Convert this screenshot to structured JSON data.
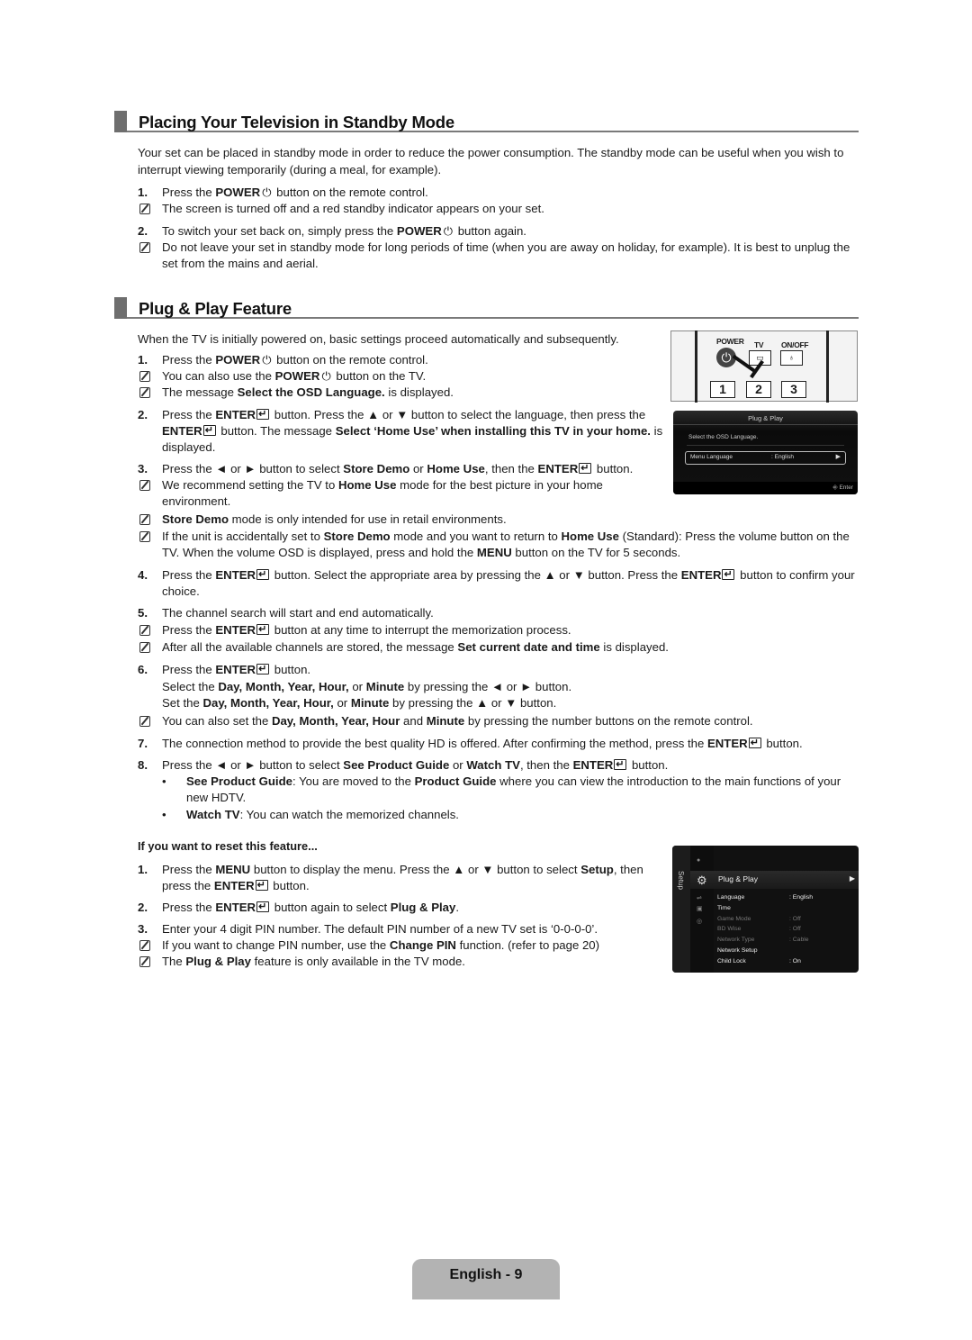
{
  "section1": {
    "title": "Placing Your Television in Standby Mode",
    "intro": "Your set can be placed in standby mode in order to reduce the power consumption. The standby mode can be useful when you wish to interrupt viewing temporarily (during a meal, for example).",
    "steps": [
      {
        "num": "1.",
        "pre": "Press the ",
        "bold": "POWER",
        "post": " button on the remote control.",
        "notes": [
          "The screen is turned off and a red standby indicator appears on your set."
        ]
      },
      {
        "num": "2.",
        "pre": "To switch your set back on, simply press the ",
        "bold": "POWER",
        "post": " button again.",
        "notes": [
          "Do not leave your set in standby mode for long periods of time (when you are away on holiday, for example). It is best to unplug the set from the mains and aerial."
        ]
      }
    ]
  },
  "section2": {
    "title": "Plug & Play Feature",
    "intro": "When the TV is initially powered on, basic settings proceed automatically and subsequently.",
    "step1": {
      "num": "1.",
      "text_a": "Press the ",
      "bold": "POWER",
      "text_b": " button on the remote control.",
      "note1_a": "You can also use the ",
      "note1_bold": "POWER",
      "note1_b": " button on the TV.",
      "note2_a": "The message ",
      "note2_bold": "Select the OSD Language.",
      "note2_b": " is displayed."
    },
    "step2": {
      "num": "2.",
      "a": "Press the ",
      "b1": "ENTER",
      "c": " button. Press the ▲ or ▼ button to select the language, then press the ",
      "b2": "ENTER",
      "d": " button. The message ",
      "b3": "Select ‘Home Use’ when installing this TV in your home.",
      "e": " is displayed."
    },
    "step3": {
      "num": "3.",
      "a": "Press the ◄ or ► button to select ",
      "b1": "Store Demo",
      "c": " or ",
      "b2": "Home Use",
      "d": ", then the ",
      "b3": "ENTER",
      "e": " button.",
      "note1_a": "We recommend setting the TV to ",
      "note1_bold": "Home Use",
      "note1_b": " mode for the best picture in your home environment.",
      "note2_bold": "Store Demo",
      "note2_b": " mode is only intended for use in retail environments.",
      "note3_a": "If the unit is accidentally set to ",
      "note3_b1": "Store Demo",
      "note3_c": " mode and you want to return to ",
      "note3_b2": "Home Use",
      "note3_d": " (Standard): Press the volume button on the TV. When the volume OSD is displayed, press and hold the ",
      "note3_b3": "MENU",
      "note3_e": " button on the TV for 5 seconds."
    },
    "step4": {
      "num": "4.",
      "a": "Press the ",
      "b1": "ENTER",
      "c": " button. Select the appropriate area by pressing the ▲ or ▼ button. Press the ",
      "b2": "ENTER",
      "d": " button to confirm your choice."
    },
    "step5": {
      "num": "5.",
      "a": "The channel search will start and end automatically.",
      "note1_a": "Press the ",
      "note1_bold": "ENTER",
      "note1_b": " button at any time to interrupt the memorization process.",
      "note2_a": "After all the available channels are stored, the message ",
      "note2_bold": "Set current date and time",
      "note2_b": " is displayed."
    },
    "step6": {
      "num": "6.",
      "a": "Press the ",
      "b1": "ENTER",
      "c": " button.",
      "line2_a": "Select the ",
      "line2_bold": "Day, Month, Year, Hour,",
      "line2_b": " or ",
      "line2_bold2": "Minute",
      "line2_c": " by pressing the ◄ or ► button.",
      "line3_a": "Set the ",
      "line3_bold": "Day, Month, Year, Hour,",
      "line3_b": " or ",
      "line3_bold2": "Minute",
      "line3_c": " by pressing the ▲ or ▼ button.",
      "note_a": "You can also set the ",
      "note_bold": "Day, Month, Year, Hour",
      "note_b": " and ",
      "note_bold2": "Minute",
      "note_c": " by pressing the number buttons on the remote control."
    },
    "step7": {
      "num": "7.",
      "a": "The connection method to provide the best quality HD is offered. After confirming the method, press the ",
      "b1": "ENTER",
      "c": " button."
    },
    "step8": {
      "num": "8.",
      "a": "Press the ◄ or ► button to select ",
      "b1": "See Product Guide",
      "c": " or ",
      "b2": "Watch TV",
      "d": ", then the ",
      "b3": "ENTER",
      "e": " button.",
      "bullet1_bold": "See Product Guide",
      "bullet1_a": ": You are moved to the ",
      "bullet1_bold2": "Product Guide",
      "bullet1_b": " where you can view the introduction to the main functions of your new HDTV.",
      "bullet2_bold": "Watch TV",
      "bullet2_a": ": You can watch the memorized channels."
    },
    "reset": {
      "heading": "If you want to reset this feature...",
      "s1_num": "1.",
      "s1_a": "Press the ",
      "s1_b1": "MENU",
      "s1_c": " button to display the menu. Press the ▲ or ▼ button to select ",
      "s1_b2": "Setup",
      "s1_d": ", then press the ",
      "s1_b3": "ENTER",
      "s1_e": " button.",
      "s2_num": "2.",
      "s2_a": "Press the ",
      "s2_b1": "ENTER",
      "s2_c": " button again to select ",
      "s2_b2": "Plug & Play",
      "s2_d": ".",
      "s3_num": "3.",
      "s3_a": "Enter your 4 digit PIN number. The default PIN number of a new TV set is ‘0-0-0-0’.",
      "s3_note1_a": "If you want to change PIN number, use the ",
      "s3_note1_bold": "Change PIN",
      "s3_note1_b": " function. (refer to page 20)",
      "s3_note2_a": "The ",
      "s3_note2_bold": "Plug & Play",
      "s3_note2_b": " feature is only available in the TV mode."
    }
  },
  "remote": {
    "power": "POWER",
    "tv": "TV",
    "onoff": "ON/OFF",
    "buttons": [
      "1",
      "2",
      "3"
    ]
  },
  "osd_language": {
    "title": "Plug & Play",
    "message": "Select the OSD Language.",
    "field_label": "Menu Language",
    "field_value": ": English",
    "footer": "Enter"
  },
  "osd_setup": {
    "side_label": "Setup",
    "selected": "Plug & Play",
    "rows": [
      {
        "label": "Language",
        "value": ": English",
        "state": "bright"
      },
      {
        "label": "Time",
        "value": "",
        "state": "bright"
      },
      {
        "label": "Game Mode",
        "value": ": Off",
        "state": "dim"
      },
      {
        "label": "BD Wise",
        "value": ": Off",
        "state": "dim"
      },
      {
        "label": "Network Type",
        "value": ": Cable",
        "state": "dim"
      },
      {
        "label": "Network Setup",
        "value": "",
        "state": "bright"
      },
      {
        "label": "Child Lock",
        "value": ": On",
        "state": "bright"
      }
    ]
  },
  "footer": {
    "page_label": "English - 9"
  }
}
